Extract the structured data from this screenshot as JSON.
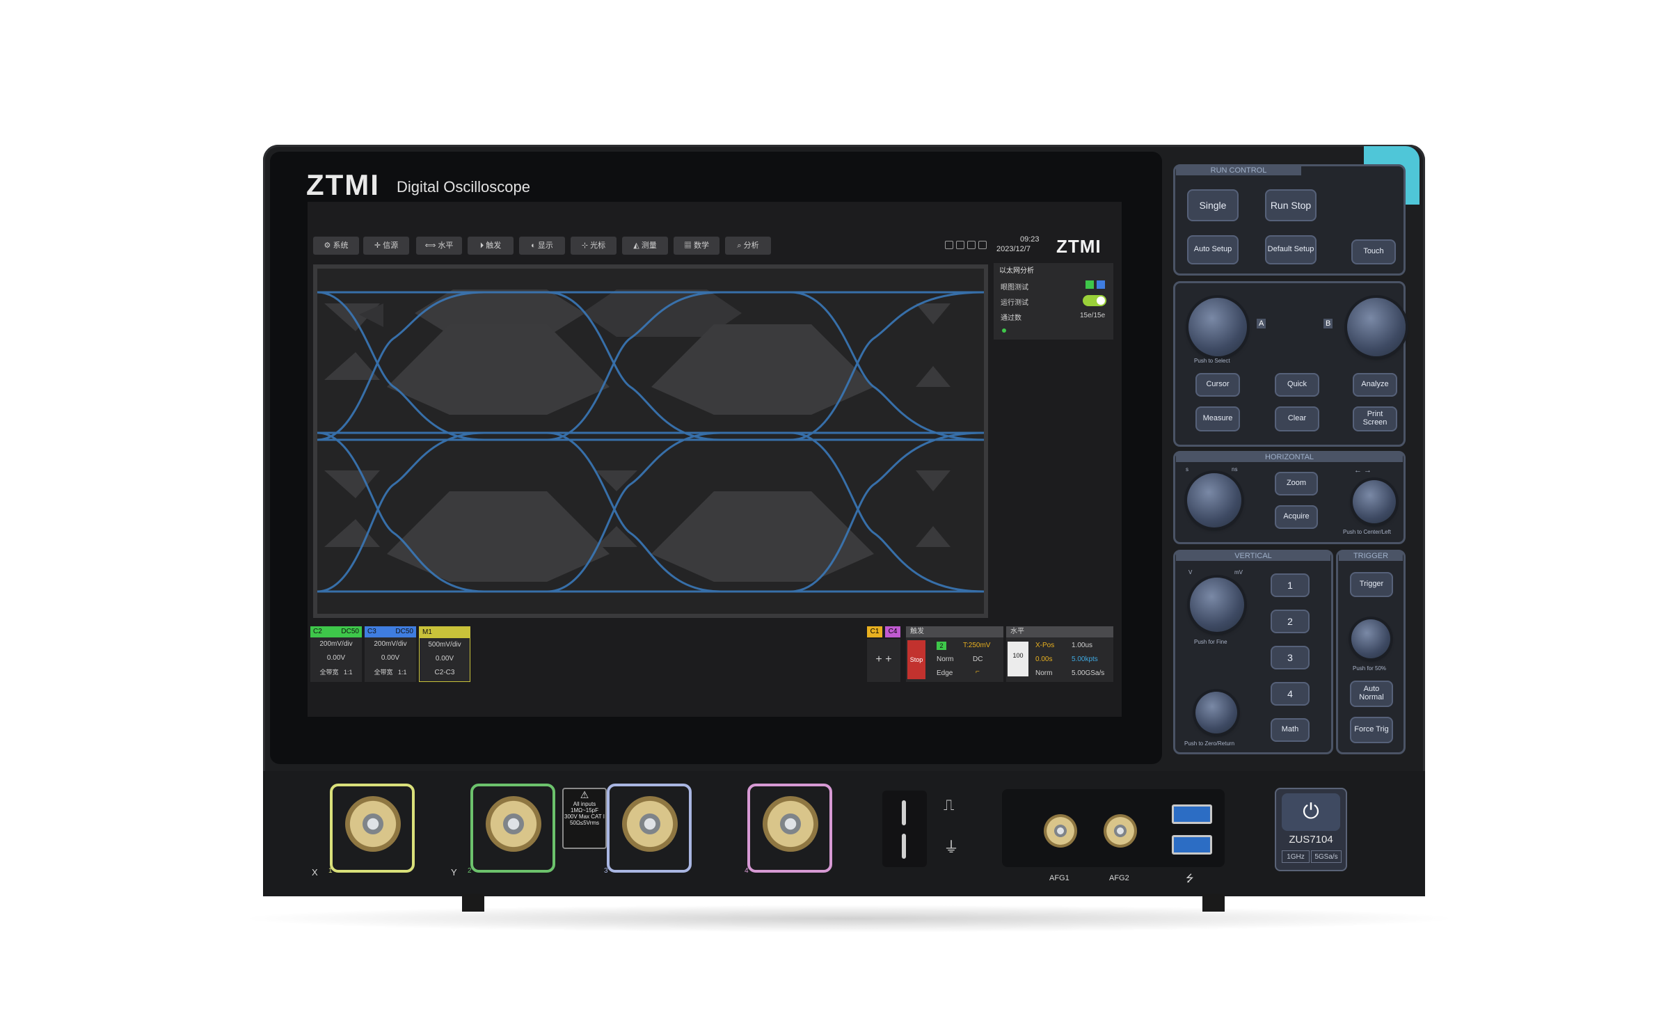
{
  "brand": {
    "logo": "ZTMI",
    "subtitle": "Digital Oscilloscope"
  },
  "screen": {
    "menu": [
      "系统",
      "信源",
      "水平",
      "触发",
      "显示",
      "光标",
      "测量",
      "数学",
      "分析"
    ],
    "time": "09:23",
    "date": "2023/12/7",
    "logo": "ZTMI",
    "side_panel": {
      "title": "以太网分析",
      "rows": [
        {
          "label": "眼图测试",
          "value": ""
        },
        {
          "label": "运行测试",
          "value": ""
        },
        {
          "label": "通过数",
          "value": "15e/15e"
        }
      ]
    },
    "channels": [
      {
        "name": "C2",
        "coupling": "DC50",
        "scale": "200mV/div",
        "offset": "0.00V",
        "bw": "全带宽",
        "ratio": "1:1",
        "color": "#3ec74a"
      },
      {
        "name": "C3",
        "coupling": "DC50",
        "scale": "200mV/div",
        "offset": "0.00V",
        "bw": "全带宽",
        "ratio": "1:1",
        "color": "#3f7de0"
      },
      {
        "name": "M1",
        "coupling": "",
        "scale": "500mV/div",
        "offset": "0.00V",
        "bw": "C2-C3",
        "ratio": "",
        "color": "#c9c23a"
      }
    ],
    "trigger_tabs": [
      "C1",
      "C4"
    ],
    "trigger": {
      "title": "触发",
      "state": "Stop",
      "source": "2",
      "level": "T:250mV",
      "mode": "Norm",
      "coupling": "DC",
      "type": "Edge"
    },
    "horizontal": {
      "title": "水平",
      "sample": "100",
      "xpos_label": "X-Pos",
      "xpos": "1.00us",
      "pos": "0.00s",
      "points": "5.00kpts",
      "mode": "Norm",
      "rate": "5.00GSa/s"
    }
  },
  "controls": {
    "run_control": {
      "title": "RUN CONTROL",
      "single": "Single",
      "run_stop": "Run Stop",
      "auto_setup": "Auto Setup",
      "default_setup": "Default Setup",
      "touch": "Touch"
    },
    "multi": {
      "knob_a": "A",
      "knob_b": "B",
      "push_select": "Push to Select",
      "cursor": "Cursor",
      "quick": "Quick",
      "analyze": "Analyze",
      "measure": "Measure",
      "clear": "Clear",
      "print": "Print Screen"
    },
    "horizontal": {
      "title": "HORIZONTAL",
      "s": "s",
      "ns": "ns",
      "zoom": "Zoom",
      "acquire": "Acquire",
      "push_center": "Push to Center/Left"
    },
    "vertical": {
      "title": "VERTICAL",
      "v": "V",
      "mv": "mV",
      "push_fine": "Push for Fine",
      "push_zero": "Push to Zero/Return",
      "ch1": "1",
      "ch2": "2",
      "ch3": "3",
      "ch4": "4",
      "math": "Math"
    },
    "trigger": {
      "title": "TRIGGER",
      "trigger": "Trigger",
      "push_50": "Push for 50%",
      "auto_normal": "Auto Normal",
      "force_trig": "Force Trig"
    }
  },
  "front": {
    "inputs": [
      {
        "label": "X",
        "num": "1",
        "color": "#d9e07a"
      },
      {
        "label": "Y",
        "num": "2",
        "color": "#6cc26c"
      },
      {
        "label": "",
        "num": "3",
        "color": "#a9b6e2"
      },
      {
        "label": "",
        "num": "4",
        "color": "#d79ad4"
      }
    ],
    "warning": "All inputs 1MΩ~15pF 300V Max CAT I 50Ω≤5Vrms",
    "afg1": "AFG1",
    "afg2": "AFG2",
    "model": "ZUS7104",
    "spec_bw": "1GHz",
    "spec_rate": "5GSa/s"
  }
}
